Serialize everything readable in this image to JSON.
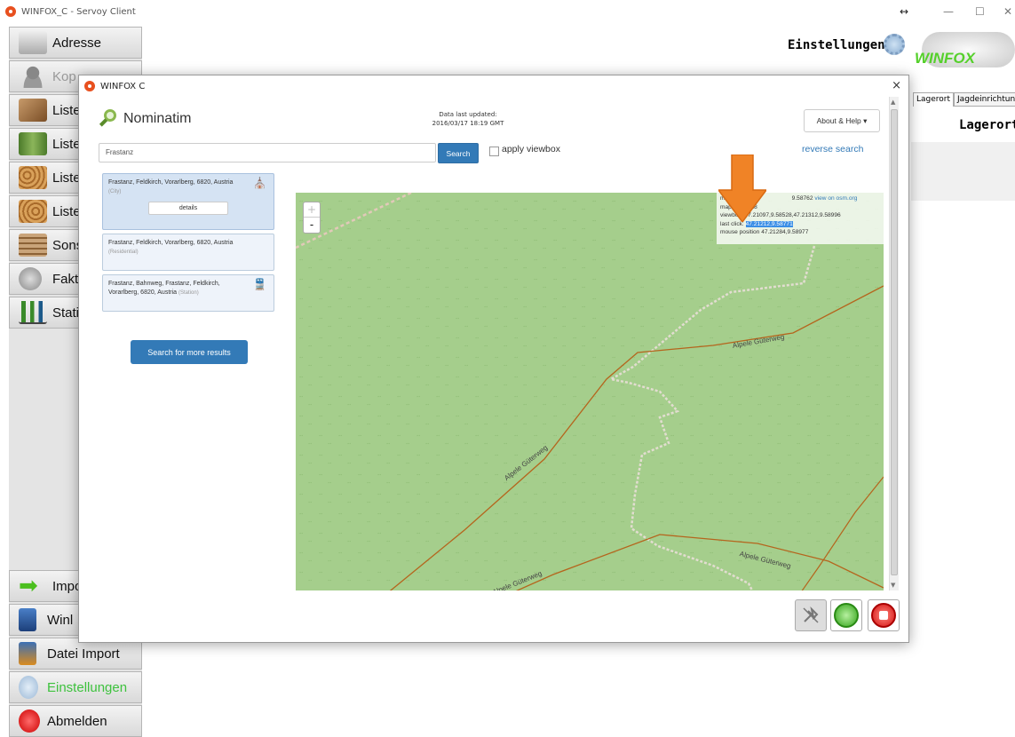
{
  "window": {
    "title": "WINFOX_C - Servoy Client",
    "resize_glyph": "↔",
    "minimize": "—",
    "maximize": "☐",
    "close": "✕"
  },
  "sidebar": {
    "items": [
      {
        "label": "Adresse",
        "icon": "address-icon",
        "state": "normal"
      },
      {
        "label": "Kop",
        "icon": "person-icon",
        "state": "disabled"
      },
      {
        "label": "Liste",
        "icon": "wood-log-icon",
        "state": "normal"
      },
      {
        "label": "Liste",
        "icon": "tree-icon",
        "state": "normal"
      },
      {
        "label": "Liste",
        "icon": "firewood-icon",
        "state": "normal"
      },
      {
        "label": "Liste",
        "icon": "firewood-icon",
        "state": "normal"
      },
      {
        "label": "Sons",
        "icon": "lumber-icon",
        "state": "normal"
      },
      {
        "label": "Fakt",
        "icon": "coin-icon",
        "state": "normal"
      },
      {
        "label": "Stati",
        "icon": "bar-chart-icon",
        "state": "normal"
      },
      {
        "label": "Impo",
        "icon": "arrow-right-icon",
        "state": "normal"
      },
      {
        "label": "Winl",
        "icon": "handheld-device-icon",
        "state": "normal"
      },
      {
        "label": "Datei Import",
        "icon": "handheld-import-icon",
        "state": "normal"
      },
      {
        "label": "Einstellungen",
        "icon": "gear-icon",
        "state": "active"
      },
      {
        "label": "Abmelden",
        "icon": "stop-icon",
        "state": "normal"
      }
    ]
  },
  "header": {
    "settings_label": "Einstellungen",
    "brand": "WINFOX"
  },
  "right_panel": {
    "tabs": [
      "Lagerort",
      "Jagdeinrichtung"
    ],
    "title": "Lagerort"
  },
  "dialog": {
    "title": "WINFOX C",
    "close": "×",
    "nominatim": {
      "brand": "Nominatim",
      "updated_label": "Data last updated:",
      "updated_value": "2016/03/17 18:19 GMT",
      "about_button": "About & Help ▾",
      "search_value": "Frastanz",
      "search_button": "Search",
      "viewbox_label": "apply viewbox",
      "viewbox_checked": false,
      "reverse_link": "reverse search",
      "results": [
        {
          "name": "Frastanz, Feldkirch, Vorarlberg, 6820, Austria",
          "type": "(City)",
          "icon": "city-icon",
          "selected": true,
          "details": "details"
        },
        {
          "name": "Frastanz, Feldkirch, Vorarlberg, 6820, Austria",
          "type": "(Residential)",
          "icon": "",
          "selected": false
        },
        {
          "name": "Frastanz, Bahnweg, Frastanz, Feldkirch, Vorarlberg, 6820, Austria",
          "type": "(Station)",
          "icon": "train-icon",
          "selected": false
        }
      ],
      "more_button": "Search for more results",
      "map": {
        "zoom_in": "+",
        "zoom_out": "-",
        "center_label": "map center:",
        "center_value": "9.58762",
        "osm_link": "view on osm.org",
        "zoom_label": "map zoom:",
        "zoom_value": "18",
        "viewbox_label": "viewbox:",
        "viewbox_value": "47.21097,9.58528,47.21312,9.58996",
        "last_click_label": "last click:",
        "last_click_value": "47.21212,9.58771",
        "mouse_label": "mouse position",
        "mouse_value": "47.21284,9.58977",
        "road_name": "Alpele Güterweg"
      }
    },
    "footer": {
      "buttons": [
        "no-gps-button",
        "refresh-button",
        "stop-button"
      ]
    }
  },
  "colors": {
    "accent": "#337ab7",
    "map_bg": "#a5ce8c",
    "road": "#b5651d",
    "arrow": "#f08326",
    "active_green": "#3ec23e"
  }
}
